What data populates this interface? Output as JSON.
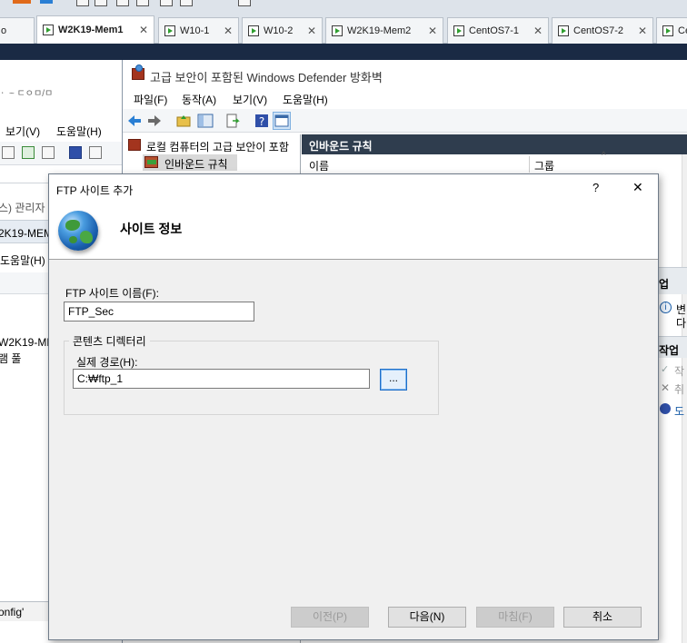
{
  "vm_tabs": [
    {
      "label": "o",
      "active": false
    },
    {
      "label": "W2K19-Mem1",
      "active": true
    },
    {
      "label": "W10-1",
      "active": false
    },
    {
      "label": "W10-2",
      "active": false
    },
    {
      "label": "W2K19-Mem2",
      "active": false
    },
    {
      "label": "CentOS7-1",
      "active": false
    },
    {
      "label": "CentOS7-2",
      "active": false
    },
    {
      "label": "Ce",
      "active": false
    }
  ],
  "background_window": {
    "menu_partial": "보기(V)",
    "menu_help": "도움말(H)",
    "title_partial": "스) 관리자",
    "node_partial": "2K19-MEM",
    "help_partial": "도움말(H)",
    "tree_item": "W2K19-ME",
    "tree_sub": "램 풀",
    "status": "onfig'"
  },
  "firewall_window": {
    "title": "고급 보안이 포함된 Windows Defender 방화벽",
    "menus": [
      "파일(F)",
      "동작(A)",
      "보기(V)",
      "도움말(H)"
    ],
    "tree_root": "로컬 컴퓨터의 고급 보안이 포함",
    "tree_inbound": "인바운드 규칙",
    "pane_header": "인바운드 규칙",
    "col_name": "이름",
    "col_group": "그룹",
    "actions_header_1": "업",
    "actions_header_2": "작업",
    "action_items": [
      "변",
      "다",
      "작",
      "취",
      "도"
    ]
  },
  "dialog": {
    "title": "FTP 사이트 추가",
    "help_label": "?",
    "close_label": "✕",
    "header": "사이트 정보",
    "site_name_label": "FTP 사이트 이름(F):",
    "site_name_value": "FTP_Sec",
    "content_dir_label": "콘텐츠 디렉터리",
    "physical_path_label": "실제 경로(H):",
    "physical_path_value": "C:₩ftp_1",
    "browse_label": "...",
    "buttons": {
      "prev": "이전(P)",
      "next": "다음(N)",
      "finish": "마침(F)",
      "cancel": "취소"
    }
  }
}
